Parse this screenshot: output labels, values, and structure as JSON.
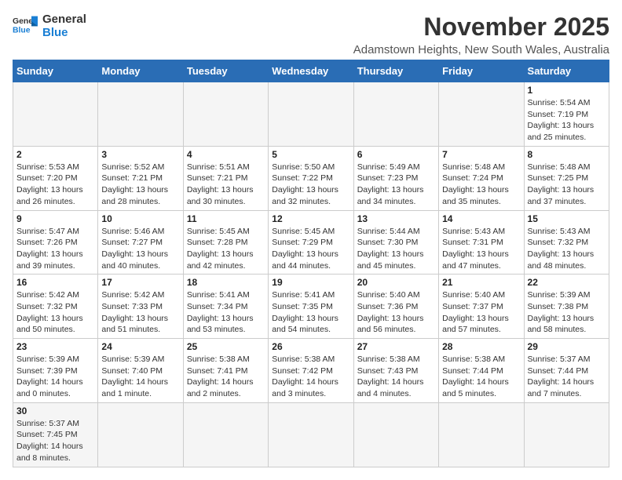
{
  "logo": {
    "line1": "General",
    "line2": "Blue"
  },
  "title": "November 2025",
  "subtitle": "Adamstown Heights, New South Wales, Australia",
  "weekdays": [
    "Sunday",
    "Monday",
    "Tuesday",
    "Wednesday",
    "Thursday",
    "Friday",
    "Saturday"
  ],
  "weeks": [
    [
      {
        "day": null,
        "info": null
      },
      {
        "day": null,
        "info": null
      },
      {
        "day": null,
        "info": null
      },
      {
        "day": null,
        "info": null
      },
      {
        "day": null,
        "info": null
      },
      {
        "day": null,
        "info": null
      },
      {
        "day": "1",
        "info": "Sunrise: 5:54 AM\nSunset: 7:19 PM\nDaylight: 13 hours\nand 25 minutes."
      }
    ],
    [
      {
        "day": "2",
        "info": "Sunrise: 5:53 AM\nSunset: 7:20 PM\nDaylight: 13 hours\nand 26 minutes."
      },
      {
        "day": "3",
        "info": "Sunrise: 5:52 AM\nSunset: 7:21 PM\nDaylight: 13 hours\nand 28 minutes."
      },
      {
        "day": "4",
        "info": "Sunrise: 5:51 AM\nSunset: 7:21 PM\nDaylight: 13 hours\nand 30 minutes."
      },
      {
        "day": "5",
        "info": "Sunrise: 5:50 AM\nSunset: 7:22 PM\nDaylight: 13 hours\nand 32 minutes."
      },
      {
        "day": "6",
        "info": "Sunrise: 5:49 AM\nSunset: 7:23 PM\nDaylight: 13 hours\nand 34 minutes."
      },
      {
        "day": "7",
        "info": "Sunrise: 5:48 AM\nSunset: 7:24 PM\nDaylight: 13 hours\nand 35 minutes."
      },
      {
        "day": "8",
        "info": "Sunrise: 5:48 AM\nSunset: 7:25 PM\nDaylight: 13 hours\nand 37 minutes."
      }
    ],
    [
      {
        "day": "9",
        "info": "Sunrise: 5:47 AM\nSunset: 7:26 PM\nDaylight: 13 hours\nand 39 minutes."
      },
      {
        "day": "10",
        "info": "Sunrise: 5:46 AM\nSunset: 7:27 PM\nDaylight: 13 hours\nand 40 minutes."
      },
      {
        "day": "11",
        "info": "Sunrise: 5:45 AM\nSunset: 7:28 PM\nDaylight: 13 hours\nand 42 minutes."
      },
      {
        "day": "12",
        "info": "Sunrise: 5:45 AM\nSunset: 7:29 PM\nDaylight: 13 hours\nand 44 minutes."
      },
      {
        "day": "13",
        "info": "Sunrise: 5:44 AM\nSunset: 7:30 PM\nDaylight: 13 hours\nand 45 minutes."
      },
      {
        "day": "14",
        "info": "Sunrise: 5:43 AM\nSunset: 7:31 PM\nDaylight: 13 hours\nand 47 minutes."
      },
      {
        "day": "15",
        "info": "Sunrise: 5:43 AM\nSunset: 7:32 PM\nDaylight: 13 hours\nand 48 minutes."
      }
    ],
    [
      {
        "day": "16",
        "info": "Sunrise: 5:42 AM\nSunset: 7:32 PM\nDaylight: 13 hours\nand 50 minutes."
      },
      {
        "day": "17",
        "info": "Sunrise: 5:42 AM\nSunset: 7:33 PM\nDaylight: 13 hours\nand 51 minutes."
      },
      {
        "day": "18",
        "info": "Sunrise: 5:41 AM\nSunset: 7:34 PM\nDaylight: 13 hours\nand 53 minutes."
      },
      {
        "day": "19",
        "info": "Sunrise: 5:41 AM\nSunset: 7:35 PM\nDaylight: 13 hours\nand 54 minutes."
      },
      {
        "day": "20",
        "info": "Sunrise: 5:40 AM\nSunset: 7:36 PM\nDaylight: 13 hours\nand 56 minutes."
      },
      {
        "day": "21",
        "info": "Sunrise: 5:40 AM\nSunset: 7:37 PM\nDaylight: 13 hours\nand 57 minutes."
      },
      {
        "day": "22",
        "info": "Sunrise: 5:39 AM\nSunset: 7:38 PM\nDaylight: 13 hours\nand 58 minutes."
      }
    ],
    [
      {
        "day": "23",
        "info": "Sunrise: 5:39 AM\nSunset: 7:39 PM\nDaylight: 14 hours\nand 0 minutes."
      },
      {
        "day": "24",
        "info": "Sunrise: 5:39 AM\nSunset: 7:40 PM\nDaylight: 14 hours\nand 1 minute."
      },
      {
        "day": "25",
        "info": "Sunrise: 5:38 AM\nSunset: 7:41 PM\nDaylight: 14 hours\nand 2 minutes."
      },
      {
        "day": "26",
        "info": "Sunrise: 5:38 AM\nSunset: 7:42 PM\nDaylight: 14 hours\nand 3 minutes."
      },
      {
        "day": "27",
        "info": "Sunrise: 5:38 AM\nSunset: 7:43 PM\nDaylight: 14 hours\nand 4 minutes."
      },
      {
        "day": "28",
        "info": "Sunrise: 5:38 AM\nSunset: 7:44 PM\nDaylight: 14 hours\nand 5 minutes."
      },
      {
        "day": "29",
        "info": "Sunrise: 5:37 AM\nSunset: 7:44 PM\nDaylight: 14 hours\nand 7 minutes."
      }
    ],
    [
      {
        "day": "30",
        "info": "Sunrise: 5:37 AM\nSunset: 7:45 PM\nDaylight: 14 hours\nand 8 minutes."
      },
      {
        "day": null,
        "info": null
      },
      {
        "day": null,
        "info": null
      },
      {
        "day": null,
        "info": null
      },
      {
        "day": null,
        "info": null
      },
      {
        "day": null,
        "info": null
      },
      {
        "day": null,
        "info": null
      }
    ]
  ]
}
